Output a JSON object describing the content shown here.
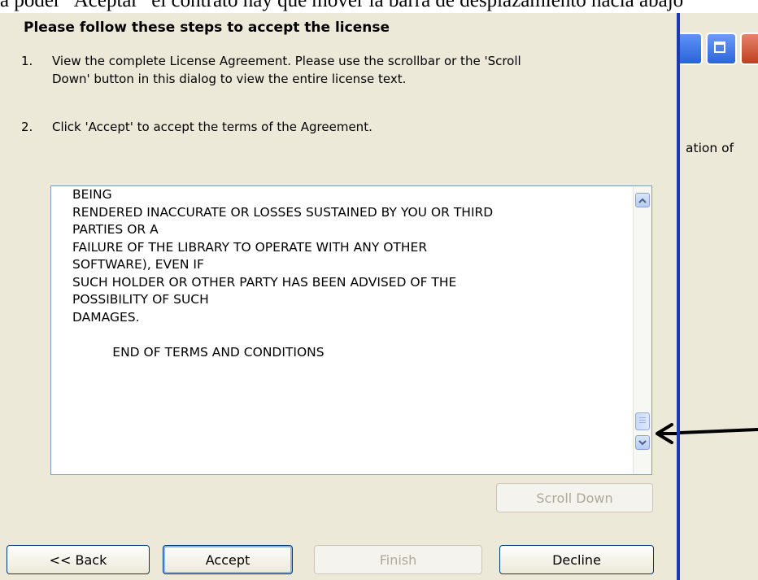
{
  "caption": "a poder \"Aceptar\" el contrato hay que mover la barra de desplazamiento hacia abajo",
  "dialog": {
    "heading": "Please follow these steps to accept the license",
    "steps": [
      {
        "num": "1.",
        "lines": [
          "View the complete License Agreement. Please use the scrollbar or the 'Scroll",
          "Down' button in this dialog to view the entire license text."
        ]
      },
      {
        "num": "2.",
        "lines": [
          "Click 'Accept' to accept the terms of the Agreement."
        ]
      }
    ],
    "license_text": [
      "BEING",
      "RENDERED INACCURATE OR LOSSES SUSTAINED BY YOU OR THIRD",
      "PARTIES OR A",
      "FAILURE OF THE LIBRARY TO OPERATE WITH ANY OTHER",
      "SOFTWARE), EVEN IF",
      "SUCH HOLDER OR OTHER PARTY HAS BEEN ADVISED OF THE",
      "POSSIBILITY OF SUCH",
      "DAMAGES.",
      "",
      "          END OF TERMS AND CONDITIONS"
    ],
    "scroll_down_label": "Scroll Down",
    "buttons": {
      "back": "<< Back",
      "accept": "Accept",
      "finish": "Finish",
      "decline": "Decline"
    }
  },
  "right_window": {
    "partial_text": "ation of"
  },
  "annotation": {
    "arrow": "left-arrow pointing at scrollbar thumb"
  }
}
